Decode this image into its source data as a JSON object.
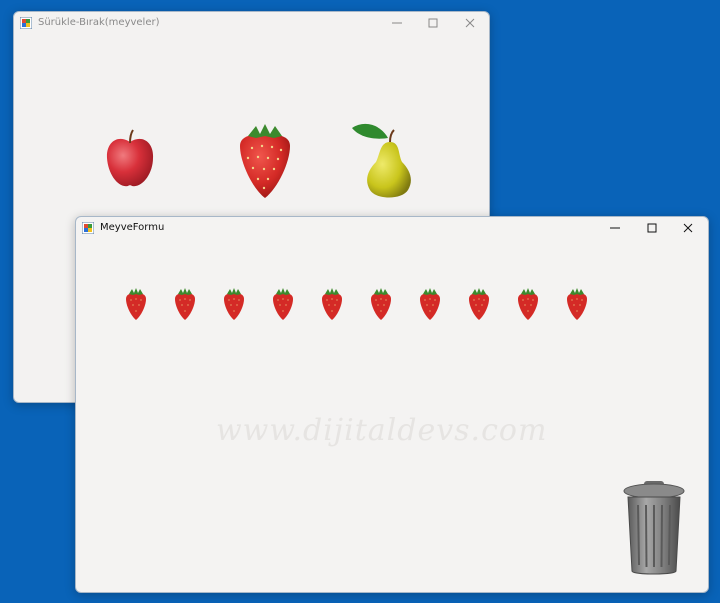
{
  "windows": {
    "back": {
      "title": "Sürükle-Bırak(meyveler)",
      "fruits": [
        "apple-icon",
        "strawberry-icon",
        "pear-icon"
      ]
    },
    "front": {
      "title": "MeyveFormu",
      "strawberry_count": 10,
      "watermark": "www.dijitaldevs.com"
    }
  },
  "colors": {
    "desktop": "#0963b8",
    "window_bg": "#f3f2f1",
    "strawberry": "#d42a26",
    "apple": "#d8303a",
    "pear": "#c9c51c",
    "leaf": "#2f8a2e",
    "trash": "#7c7c7c"
  }
}
